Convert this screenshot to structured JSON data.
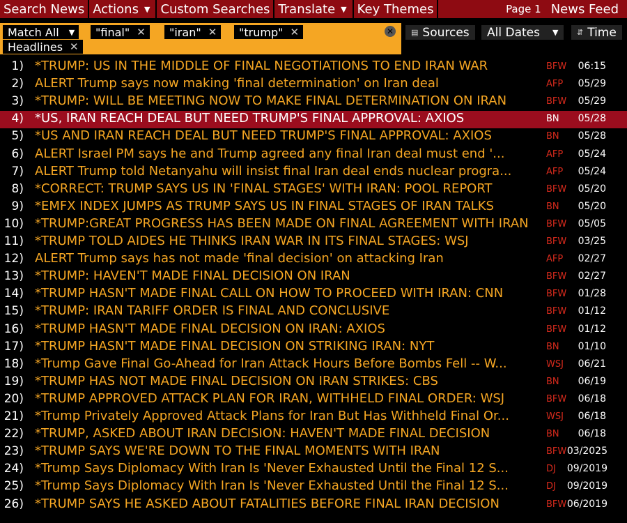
{
  "menubar": {
    "items": [
      {
        "label": "Search News",
        "dropdown": false
      },
      {
        "label": "Actions",
        "dropdown": true
      },
      {
        "label": "Custom Searches",
        "dropdown": false
      },
      {
        "label": "Translate",
        "dropdown": true
      },
      {
        "label": "Key Themes",
        "dropdown": false
      }
    ],
    "page_label": "Page 1",
    "feed_label": "News Feed"
  },
  "filters": {
    "match_mode": "Match All",
    "terms": [
      "\"final\"",
      "\"iran\"",
      "\"trump\""
    ],
    "field": "Headlines"
  },
  "controls": {
    "sources_label": "Sources",
    "dates_label": "All Dates",
    "time_label": "Time"
  },
  "colors": {
    "menu_bg": "#8e0b12",
    "headline": "#f5a623",
    "source": "#d62a1c",
    "selected_row": "#9b0d1e",
    "filter_bg": "#f5a623"
  },
  "selected_index": 3,
  "rows": [
    {
      "num": "1)",
      "headline": "*TRUMP: US IN THE MIDDLE OF FINAL NEGOTIATIONS TO END IRAN WAR",
      "source": "BFW",
      "date": "06:15"
    },
    {
      "num": "2)",
      "headline": "ALERT Trump says now making 'final determination' on Iran deal",
      "source": "AFP",
      "date": "05/29"
    },
    {
      "num": "3)",
      "headline": "*TRUMP: WILL BE MEETING NOW TO MAKE FINAL DETERMINATION ON IRAN",
      "source": "BFW",
      "date": "05/29"
    },
    {
      "num": "4)",
      "headline": "*US, IRAN REACH DEAL BUT NEED TRUMP'S FINAL APPROVAL: AXIOS",
      "source": "BN",
      "date": "05/28"
    },
    {
      "num": "5)",
      "headline": "*US AND IRAN REACH DEAL BUT NEED TRUMP'S FINAL APPROVAL: AXIOS",
      "source": "BN",
      "date": "05/28"
    },
    {
      "num": "6)",
      "headline": "ALERT Israel PM says he and Trump agreed any final Iran deal must end '...",
      "source": "AFP",
      "date": "05/24"
    },
    {
      "num": "7)",
      "headline": "ALERT Trump told Netanyahu will insist final Iran deal ends nuclear progra...",
      "source": "AFP",
      "date": "05/24"
    },
    {
      "num": "8)",
      "headline": "*CORRECT: TRUMP SAYS US IN 'FINAL STAGES' WITH IRAN: POOL REPORT",
      "source": "BFW",
      "date": "05/20"
    },
    {
      "num": "9)",
      "headline": "*EMFX INDEX JUMPS AS TRUMP SAYS US IN FINAL STAGES OF IRAN TALKS",
      "source": "BN",
      "date": "05/20"
    },
    {
      "num": "10)",
      "headline": "*TRUMP:GREAT PROGRESS HAS BEEN MADE ON FINAL AGREEMENT WITH IRAN",
      "source": "BFW",
      "date": "05/05"
    },
    {
      "num": "11)",
      "headline": "*TRUMP TOLD AIDES HE THINKS IRAN WAR IN ITS FINAL STAGES: WSJ",
      "source": "BFW",
      "date": "03/25"
    },
    {
      "num": "12)",
      "headline": "ALERT Trump says has not made 'final decision' on attacking Iran",
      "source": "AFP",
      "date": "02/27"
    },
    {
      "num": "13)",
      "headline": "*TRUMP: HAVEN'T MADE FINAL DECISION ON IRAN",
      "source": "BFW",
      "date": "02/27"
    },
    {
      "num": "14)",
      "headline": "*TRUMP HASN'T MADE FINAL CALL ON HOW TO PROCEED WITH IRAN: CNN",
      "source": "BFW",
      "date": "01/28"
    },
    {
      "num": "15)",
      "headline": "*TRUMP: IRAN TARIFF ORDER IS FINAL AND CONCLUSIVE",
      "source": "BFW",
      "date": "01/12"
    },
    {
      "num": "16)",
      "headline": "*TRUMP HASN'T MADE FINAL DECISION ON IRAN: AXIOS",
      "source": "BFW",
      "date": "01/12"
    },
    {
      "num": "17)",
      "headline": "*TRUMP HASN'T MADE FINAL DECISION ON STRIKING IRAN: NYT",
      "source": "BN",
      "date": "01/10"
    },
    {
      "num": "18)",
      "headline": "*Trump Gave Final Go-Ahead for Iran Attack Hours Before Bombs Fell -- W...",
      "source": "WSJ",
      "date": "06/21"
    },
    {
      "num": "19)",
      "headline": "*TRUMP HAS NOT MADE FINAL DECISION ON IRAN STRIKES: CBS",
      "source": "BN",
      "date": "06/19"
    },
    {
      "num": "20)",
      "headline": "*TRUMP APPROVED ATTACK PLAN FOR IRAN, WITHHELD FINAL ORDER: WSJ",
      "source": "BFW",
      "date": "06/18"
    },
    {
      "num": "21)",
      "headline": "*Trump Privately Approved Attack Plans for Iran But Has Withheld Final Or...",
      "source": "WSJ",
      "date": "06/18"
    },
    {
      "num": "22)",
      "headline": "*TRUMP, ASKED ABOUT IRAN DECISION: HAVEN'T MADE FINAL DECISION",
      "source": "BN",
      "date": "06/18"
    },
    {
      "num": "23)",
      "headline": "*TRUMP SAYS WE'RE DOWN TO THE FINAL MOMENTS WITH IRAN",
      "source": "BFW",
      "date": "03/2025"
    },
    {
      "num": "24)",
      "headline": "*Trump Says Diplomacy With Iran Is 'Never Exhausted Until the Final 12 S...",
      "source": "DJ",
      "date": "09/2019"
    },
    {
      "num": "25)",
      "headline": "*Trump Says Diplomacy With Iran Is 'Never Exhausted Until the Final 12 S...",
      "source": "DJ",
      "date": "09/2019"
    },
    {
      "num": "26)",
      "headline": "*TRUMP SAYS HE ASKED ABOUT FATALITIES BEFORE FINAL IRAN DECISION",
      "source": "BFW",
      "date": "06/2019"
    }
  ]
}
